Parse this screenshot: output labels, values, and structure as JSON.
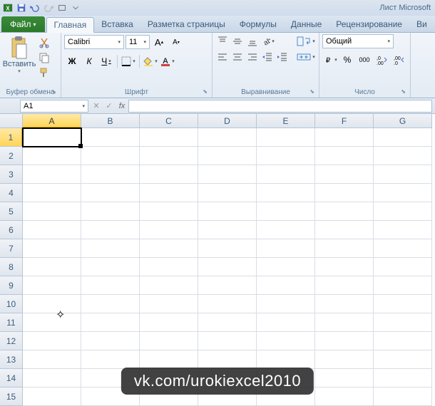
{
  "app_title": "Лист Microsoft",
  "tabs": {
    "file": "Файл",
    "home": "Главная",
    "insert": "Вставка",
    "layout": "Разметка страницы",
    "formulas": "Формулы",
    "data": "Данные",
    "review": "Рецензирование",
    "view": "Ви"
  },
  "ribbon": {
    "clipboard": {
      "label": "Буфер обмена",
      "paste": "Вставить"
    },
    "font": {
      "label": "Шрифт",
      "name": "Calibri",
      "size": "11",
      "bold": "Ж",
      "italic": "К",
      "under": "Ч"
    },
    "align": {
      "label": "Выравнивание"
    },
    "number": {
      "label": "Число",
      "format": "Общий",
      "percent": "%",
      "thousands": "000"
    }
  },
  "namebox": {
    "cell": "A1",
    "fx": "fx"
  },
  "columns": [
    "A",
    "B",
    "C",
    "D",
    "E",
    "F",
    "G"
  ],
  "rows": [
    "1",
    "2",
    "3",
    "4",
    "5",
    "6",
    "7",
    "8",
    "9",
    "10",
    "11",
    "12",
    "13",
    "14",
    "15"
  ],
  "active": {
    "col": 0,
    "row": 0
  },
  "watermark": "vk.com/urokiexcel2010"
}
